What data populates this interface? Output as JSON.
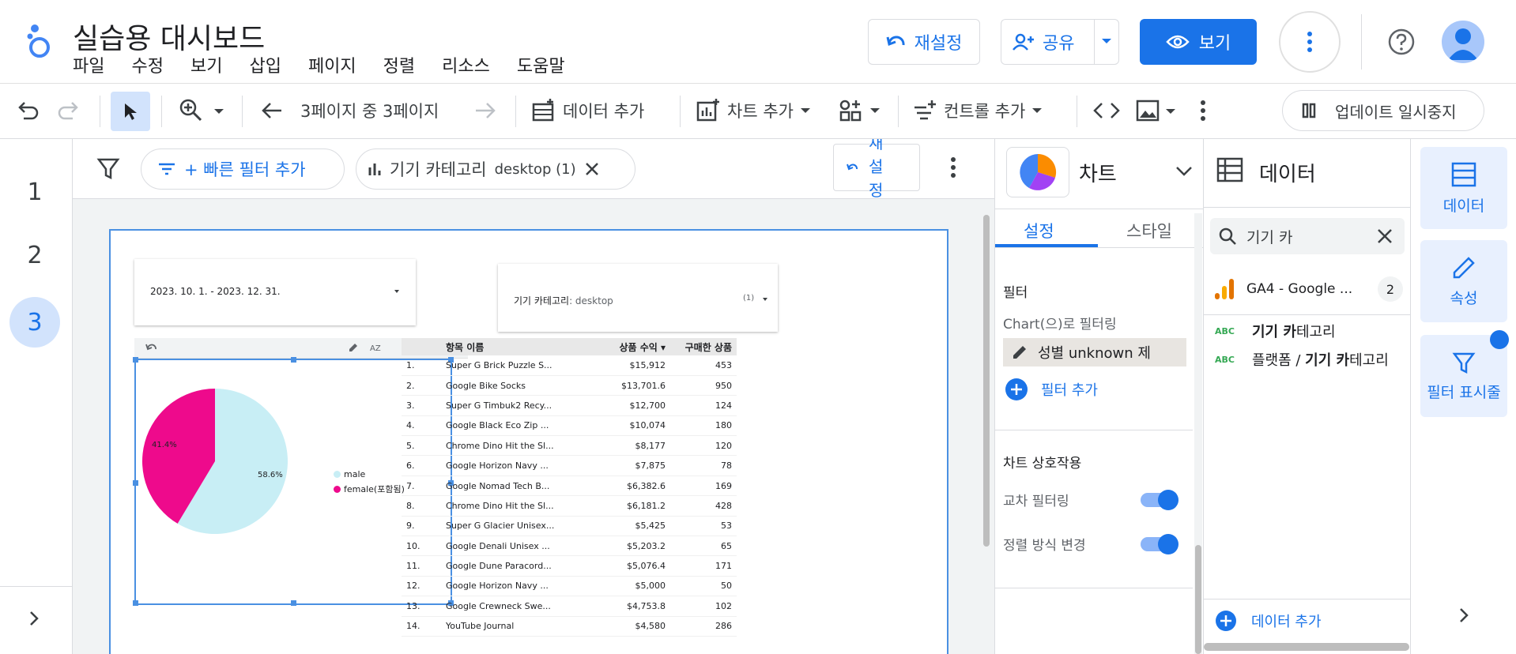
{
  "app": {
    "title": "실습용 대시보드",
    "menu": [
      "파일",
      "수정",
      "보기",
      "삽입",
      "페이지",
      "정렬",
      "리소스",
      "도움말"
    ],
    "reset_label": "재설정",
    "share_label": "공유",
    "view_label": "보기"
  },
  "toolbar": {
    "page_indicator": "3페이지 중 3페이지",
    "add_data": "데이터 추가",
    "add_chart": "차트 추가",
    "add_control": "컨트롤 추가",
    "pause_updates": "업데이트 일시중지"
  },
  "pages": [
    "1",
    "2",
    "3"
  ],
  "current_page": "3",
  "filterbar": {
    "quick_filter": "+ 빠른 필터 추가",
    "filter_chip": "기기 카테고리",
    "filter_chip_value": "desktop (1)",
    "reset_label": "재설정"
  },
  "report": {
    "date_control": "2023. 10. 1. - 2023. 12. 31.",
    "device_control_label": "기기 카테고리",
    "device_control_value": ": desktop",
    "device_control_count": "(1)",
    "pie": {
      "legend": [
        "male",
        "female(포함됨)"
      ],
      "female_label": "41.4%",
      "male_label": "58.6%"
    }
  },
  "chart_data": {
    "type": "pie",
    "categories": [
      "male",
      "female(포함됨)"
    ],
    "values": [
      58.6,
      41.4
    ],
    "colors": [
      "#c8eef5",
      "#ee0a8c"
    ]
  },
  "table": {
    "headers": [
      "",
      "항목 이름",
      "상품 수익 ▾",
      "구매한 상품"
    ],
    "rows": [
      [
        "1.",
        "Super G Brick Puzzle S...",
        "$15,912",
        "453"
      ],
      [
        "2.",
        "Google Bike Socks",
        "$13,701.6",
        "950"
      ],
      [
        "3.",
        "Super G Timbuk2 Recy...",
        "$12,700",
        "124"
      ],
      [
        "4.",
        "Google Black Eco Zip ...",
        "$10,074",
        "180"
      ],
      [
        "5.",
        "Chrome Dino Hit the Sl...",
        "$8,177",
        "120"
      ],
      [
        "6.",
        "Google Horizon Navy ...",
        "$7,875",
        "78"
      ],
      [
        "7.",
        "Google Nomad Tech B...",
        "$6,382.6",
        "169"
      ],
      [
        "8.",
        "Chrome Dino Hit the Sl...",
        "$6,181.2",
        "428"
      ],
      [
        "9.",
        "Super G Glacier Unisex...",
        "$5,425",
        "53"
      ],
      [
        "10.",
        "Google Denali Unisex ...",
        "$5,203.2",
        "65"
      ],
      [
        "11.",
        "Google Dune Paracord...",
        "$5,076.4",
        "171"
      ],
      [
        "12.",
        "Google Horizon Navy ...",
        "$5,000",
        "50"
      ],
      [
        "13.",
        "Google Crewneck Swe...",
        "$4,753.8",
        "102"
      ],
      [
        "14.",
        "YouTube Journal",
        "$4,580",
        "286"
      ]
    ]
  },
  "props": {
    "panel_title": "차트",
    "tab_setup": "설정",
    "tab_style": "스타일",
    "filter_heading": "필터",
    "filter_by_chart": "Chart(으)로 필터링",
    "filter_item": "성별 unknown 제",
    "add_filter": "필터 추가",
    "interaction_heading": "차트 상호작용",
    "cross_filter": "교차 필터링",
    "change_sort": "정렬 방식 변경"
  },
  "datapanel": {
    "title": "데이터",
    "search_value": "기기 카",
    "source_name": "GA4 - Google ...",
    "source_count": "2",
    "field1_bold": "기기 카",
    "field1_rest": "테고리",
    "field2_pre": "플랫폼 / ",
    "field2_bold": "기기 카",
    "field2_rest": "테고리",
    "field_type": "ABC",
    "add_data": "데이터 추가"
  },
  "rail": {
    "data": "데이터",
    "properties": "속성",
    "filter_bar": "필터 표시줄"
  }
}
